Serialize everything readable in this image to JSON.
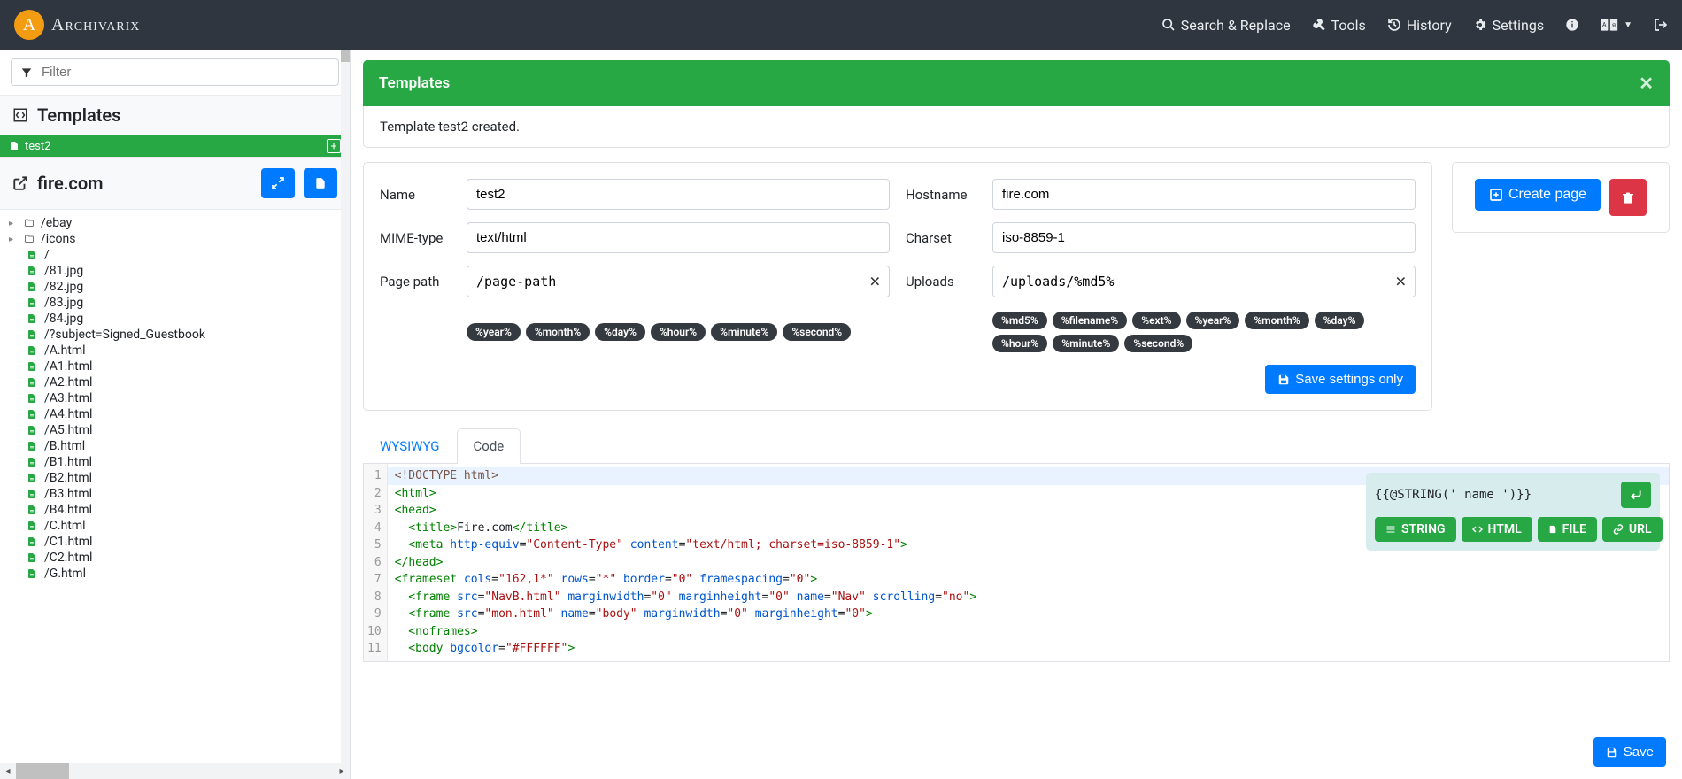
{
  "brand": {
    "name": "Archivarix",
    "badge": "A"
  },
  "topnav": {
    "search": "Search & Replace",
    "tools": "Tools",
    "history": "History",
    "settings": "Settings"
  },
  "sidebar": {
    "filter_placeholder": "Filter",
    "templates_heading": "Templates",
    "template_item": "test2",
    "domain": "fire.com",
    "folders": [
      "/ebay",
      "/icons"
    ],
    "files": [
      "/",
      "/81.jpg",
      "/82.jpg",
      "/83.jpg",
      "/84.jpg",
      "/?subject=Signed_Guestbook",
      "/A.html",
      "/A1.html",
      "/A2.html",
      "/A3.html",
      "/A4.html",
      "/A5.html",
      "/B.html",
      "/B1.html",
      "/B2.html",
      "/B3.html",
      "/B4.html",
      "/C.html",
      "/C1.html",
      "/C2.html",
      "/G.html"
    ]
  },
  "alert": {
    "title": "Templates",
    "body": "Template test2 created."
  },
  "form": {
    "name_label": "Name",
    "name_value": "test2",
    "hostname_label": "Hostname",
    "hostname_value": "fire.com",
    "mime_label": "MIME-type",
    "mime_value": "text/html",
    "charset_label": "Charset",
    "charset_value": "iso-8859-1",
    "path_label": "Page path",
    "path_value": "/page-path",
    "uploads_label": "Uploads",
    "uploads_value": "/uploads/%md5%",
    "path_tokens": [
      "%year%",
      "%month%",
      "%day%",
      "%hour%",
      "%minute%",
      "%second%"
    ],
    "upload_tokens": [
      "%md5%",
      "%filename%",
      "%ext%",
      "%year%",
      "%month%",
      "%day%",
      "%hour%",
      "%minute%",
      "%second%"
    ],
    "save_settings": "Save settings only"
  },
  "actions": {
    "create": "Create page"
  },
  "tabs": {
    "wysiwyg": "WYSIWYG",
    "code": "Code"
  },
  "editor": {
    "line1_a": "<!DOCTYPE html>",
    "line2_a": "<",
    "line2_b": "html",
    "line2_c": ">",
    "line3_a": "<",
    "line3_b": "head",
    "line3_c": ">",
    "line4_a": "  <",
    "line4_b": "title",
    "line4_c": ">",
    "line4_d": "Fire.com",
    "line4_e": "</",
    "line4_f": "title",
    "line4_g": ">",
    "line5_a": "  <",
    "line5_b": "meta",
    "line5_c": " ",
    "line5_d": "http-equiv",
    "line5_e": "=",
    "line5_f": "\"Content-Type\"",
    "line5_g": " ",
    "line5_h": "content",
    "line5_i": "=",
    "line5_j": "\"text/html; charset=iso-8859-1\"",
    "line5_k": ">",
    "line6_a": "</",
    "line6_b": "head",
    "line6_c": ">",
    "line7_a": "<",
    "line7_b": "frameset",
    "line7_c": " ",
    "line7_d": "cols",
    "line7_e": "=",
    "line7_f": "\"162,1*\"",
    "line7_g": " ",
    "line7_h": "rows",
    "line7_i": "=",
    "line7_j": "\"*\"",
    "line7_k": " ",
    "line7_l": "border",
    "line7_m": "=",
    "line7_n": "\"0\"",
    "line7_o": " ",
    "line7_p": "framespacing",
    "line7_q": "=",
    "line7_r": "\"0\"",
    "line7_s": ">",
    "line8_a": "  <",
    "line8_b": "frame",
    "line8_c": " ",
    "line8_d": "src",
    "line8_e": "=",
    "line8_f": "\"NavB.html\"",
    "line8_g": " ",
    "line8_h": "marginwidth",
    "line8_i": "=",
    "line8_j": "\"0\"",
    "line8_k": " ",
    "line8_l": "marginheight",
    "line8_m": "=",
    "line8_n": "\"0\"",
    "line8_o": " ",
    "line8_p": "name",
    "line8_q": "=",
    "line8_r": "\"Nav\"",
    "line8_s": " ",
    "line8_t": "scrolling",
    "line8_u": "=",
    "line8_v": "\"no\"",
    "line8_w": ">",
    "line9_a": "  <",
    "line9_b": "frame",
    "line9_c": " ",
    "line9_d": "src",
    "line9_e": "=",
    "line9_f": "\"mon.html\"",
    "line9_g": " ",
    "line9_h": "name",
    "line9_i": "=",
    "line9_j": "\"body\"",
    "line9_k": " ",
    "line9_l": "marginwidth",
    "line9_m": "=",
    "line9_n": "\"0\"",
    "line9_o": " ",
    "line9_p": "marginheight",
    "line9_q": "=",
    "line9_r": "\"0\"",
    "line9_s": ">",
    "line10_a": "  <",
    "line10_b": "noframes",
    "line10_c": ">",
    "line11_a": "  <",
    "line11_b": "body",
    "line11_c": " ",
    "line11_d": "bgcolor",
    "line11_e": "=",
    "line11_f": "\"#FFFFFF\"",
    "line11_g": ">",
    "linenos": [
      "1",
      "2",
      "3",
      "4",
      "5",
      "6",
      "7",
      "8",
      "9",
      "10",
      "11"
    ]
  },
  "snippet": {
    "text": "{{@STRING(' name ')}}",
    "btns": {
      "string": "STRING",
      "html": "HTML",
      "file": "FILE",
      "url": "URL"
    }
  },
  "save_btn": "Save"
}
